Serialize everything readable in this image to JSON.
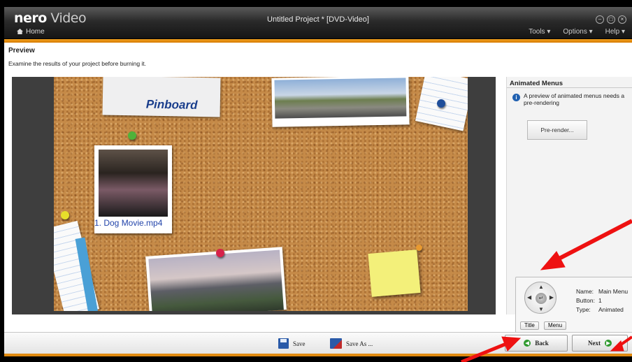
{
  "app": {
    "logo_bold": "nero",
    "logo_light": "Video",
    "window_title": "Untitled Project * [DVD-Video]",
    "home_label": "Home",
    "menus": [
      "Tools ▾",
      "Options ▾",
      "Help ▾"
    ]
  },
  "page": {
    "title": "Preview",
    "description": "Examine the results of your project before burning it."
  },
  "preview": {
    "menu_title": "Pinboard",
    "button_label": "1. Dog Movie.mp4"
  },
  "panel": {
    "title": "Animated Menus",
    "info_text": "A preview of animated menus needs a pre-rendering",
    "prerender_label": "Pre-render...",
    "name_label": "Name:",
    "name_value": "Main Menu",
    "button_label": "Button:",
    "button_value": "1",
    "type_label": "Type:",
    "type_value": "Animated",
    "title_btn": "Title",
    "menu_btn": "Menu"
  },
  "toolbar": {
    "save_label": "Save",
    "save_as_label": "Save As ...",
    "back_label": "Back",
    "next_label": "Next"
  },
  "colors": {
    "accent_orange": "#e08a10",
    "annotation_red": "#ee1111",
    "pinboard_blue": "#1a3e8c"
  }
}
